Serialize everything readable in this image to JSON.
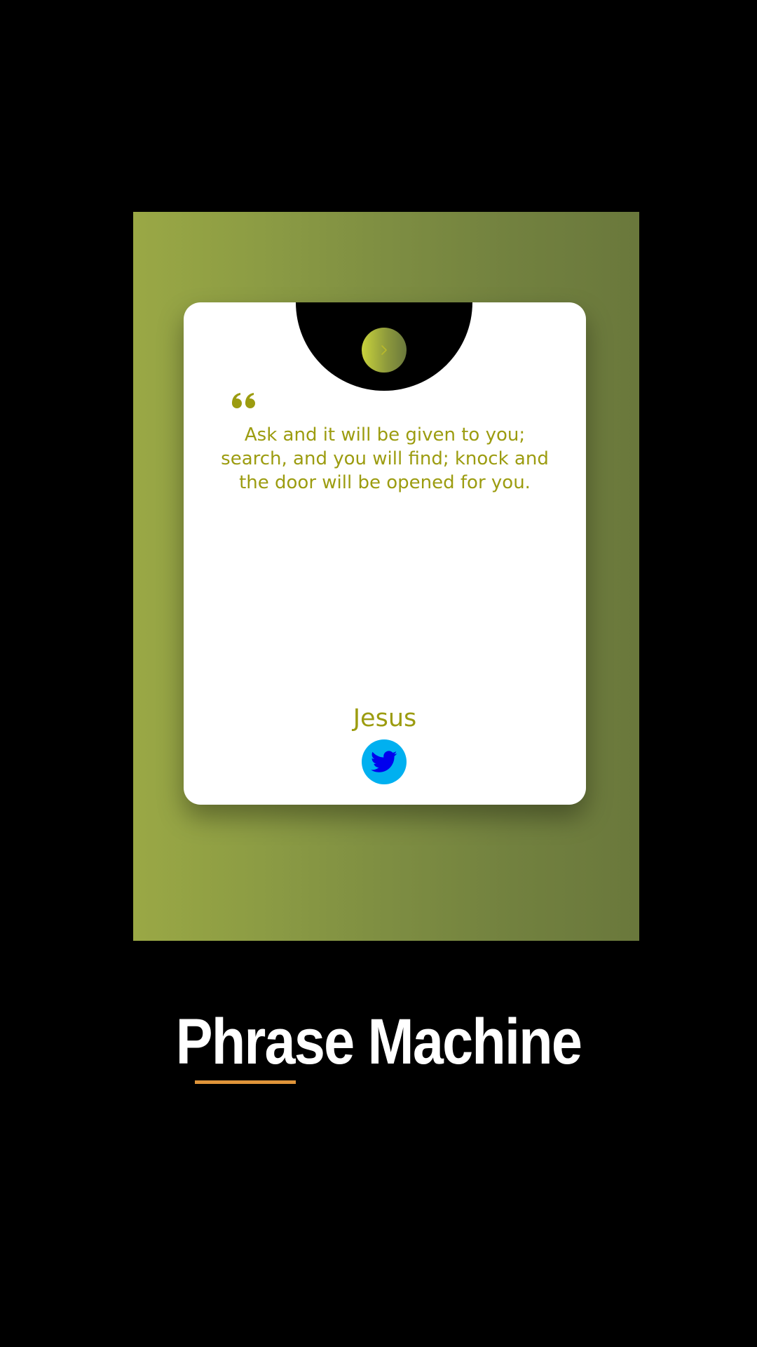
{
  "app": {
    "title": "Phrase Machine"
  },
  "card": {
    "quote": "Ask and it will be given to you; search, and you will find; knock and the door will be opened for you.",
    "author": "Jesus",
    "next_icon": "chevron-right-icon",
    "quote_icon": "quote-left-icon",
    "share_icon": "twitter-icon"
  },
  "colors": {
    "quote_text": "#9c9c10",
    "twitter_button": "#00b0f0",
    "twitter_bird": "#0000ee",
    "underline": "#e0953a"
  }
}
